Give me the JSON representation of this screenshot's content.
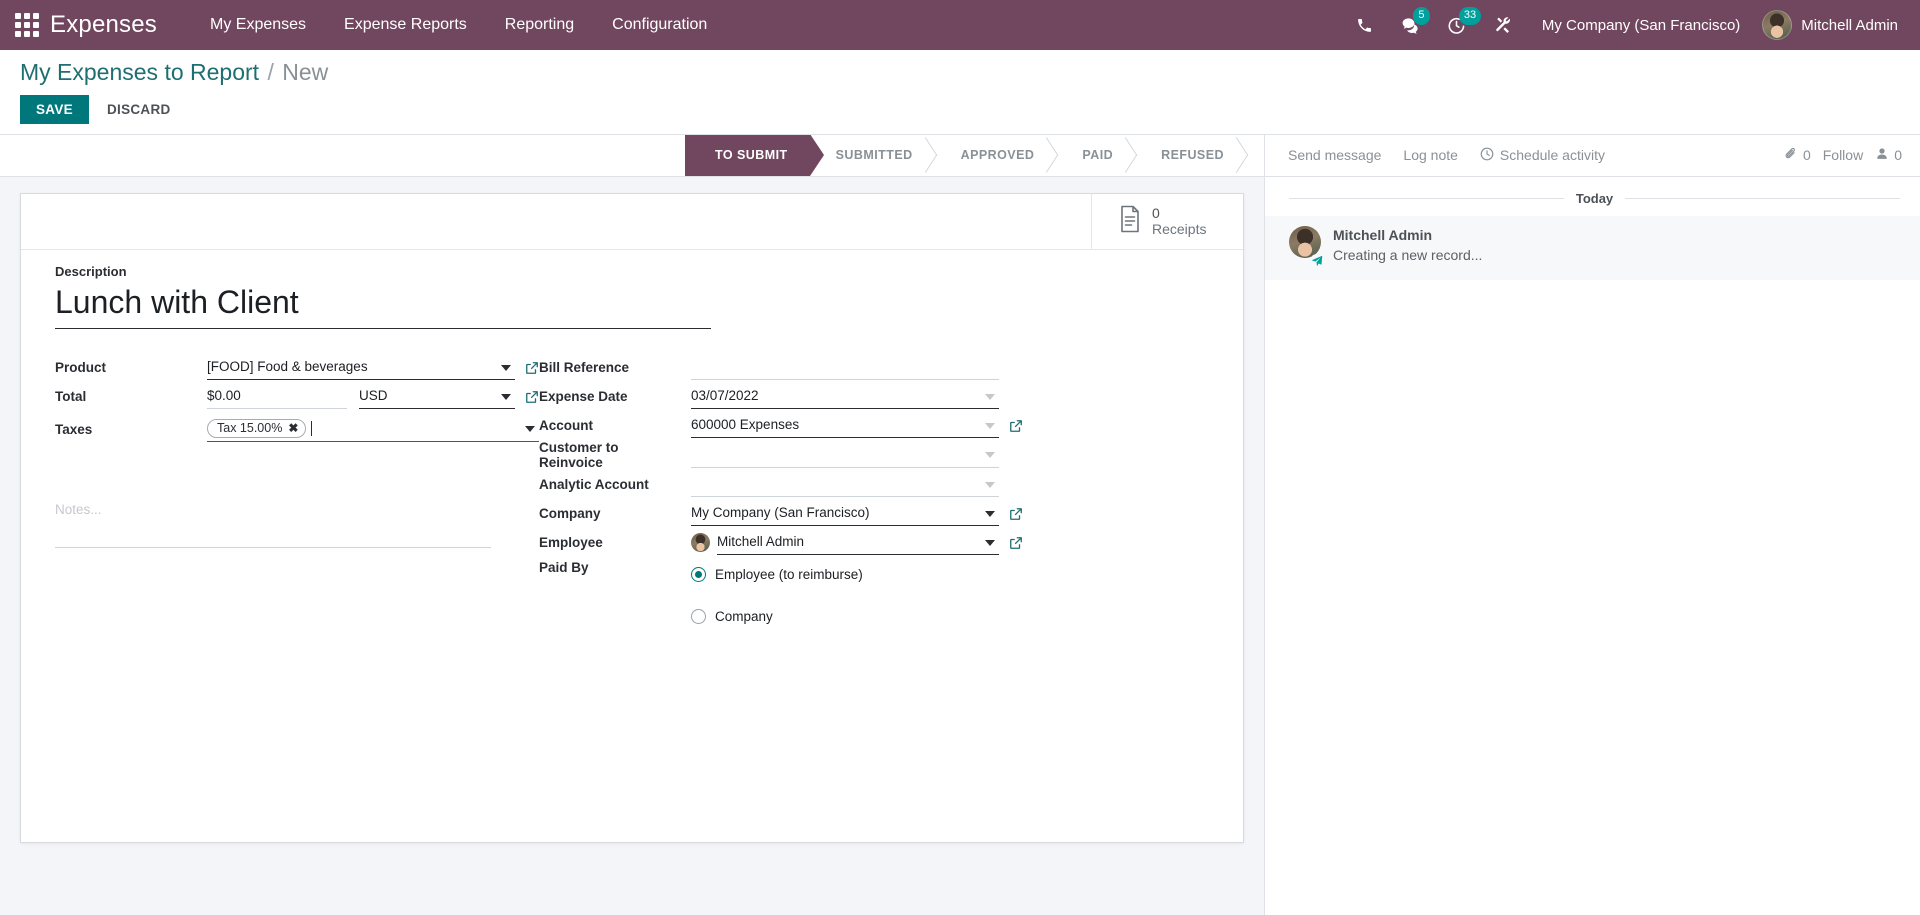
{
  "navbar": {
    "apps_icon": "apps-grid-icon",
    "brand": "Expenses",
    "menu": [
      {
        "label": "My Expenses"
      },
      {
        "label": "Expense Reports"
      },
      {
        "label": "Reporting"
      },
      {
        "label": "Configuration"
      }
    ],
    "systray": {
      "phone_icon": "phone-icon",
      "messages_icon": "messages-icon",
      "messages_count": "5",
      "activities_icon": "activity-clock-icon",
      "activities_count": "33",
      "debug_icon": "developer-tools-icon"
    },
    "company": "My Company (San Francisco)",
    "user": "Mitchell Admin",
    "accent": "#71465F",
    "badge_color": "#00A09D"
  },
  "control_panel": {
    "breadcrumb_root": "My Expenses to Report",
    "breadcrumb_sep": "/",
    "breadcrumb_current": "New",
    "save_label": "SAVE",
    "discard_label": "DISCARD",
    "save_color": "#00787B"
  },
  "statusbar": {
    "states": [
      {
        "label": "TO SUBMIT",
        "active": true
      },
      {
        "label": "SUBMITTED",
        "active": false
      },
      {
        "label": "APPROVED",
        "active": false
      },
      {
        "label": "PAID",
        "active": false
      },
      {
        "label": "REFUSED",
        "active": false
      }
    ]
  },
  "button_box": {
    "receipts_value": "0",
    "receipts_label": "Receipts",
    "receipts_icon": "document-receipt-icon"
  },
  "form": {
    "description_label": "Description",
    "description_value": "Lunch with Client",
    "left_fields": {
      "product_label": "Product",
      "product_value": "[FOOD] Food & beverages",
      "total_label": "Total",
      "total_value": "$0.00",
      "currency_value": "USD",
      "taxes_label": "Taxes",
      "taxes_tag": "Tax 15.00%",
      "taxes_tag_remove": "✖"
    },
    "right_fields": {
      "bill_reference_label": "Bill Reference",
      "bill_reference_value": "",
      "expense_date_label": "Expense Date",
      "expense_date_value": "03/07/2022",
      "account_label": "Account",
      "account_value": "600000 Expenses",
      "customer_reinvoice_label": "Customer to Reinvoice",
      "customer_reinvoice_value": "",
      "analytic_account_label": "Analytic Account",
      "analytic_account_value": "",
      "company_label": "Company",
      "company_value": "My Company (San Francisco)",
      "employee_label": "Employee",
      "employee_value": "Mitchell Admin",
      "paid_by_label": "Paid By",
      "paid_by_options": [
        {
          "label": "Employee (to reimburse)",
          "selected": true
        },
        {
          "label": "Company",
          "selected": false
        }
      ]
    },
    "notes_placeholder": "Notes..."
  },
  "chatter": {
    "send_message_label": "Send message",
    "log_note_label": "Log note",
    "schedule_activity_label": "Schedule activity",
    "schedule_activity_icon": "clock-icon",
    "attachment_icon": "paperclip-icon",
    "attachment_count": "0",
    "follow_label": "Follow",
    "followers_icon": "user-icon",
    "followers_count": "0",
    "day_separator": "Today",
    "messages": [
      {
        "author": "Mitchell Admin",
        "body": "Creating a new record...",
        "badge_icon": "paper-plane-icon"
      }
    ]
  }
}
